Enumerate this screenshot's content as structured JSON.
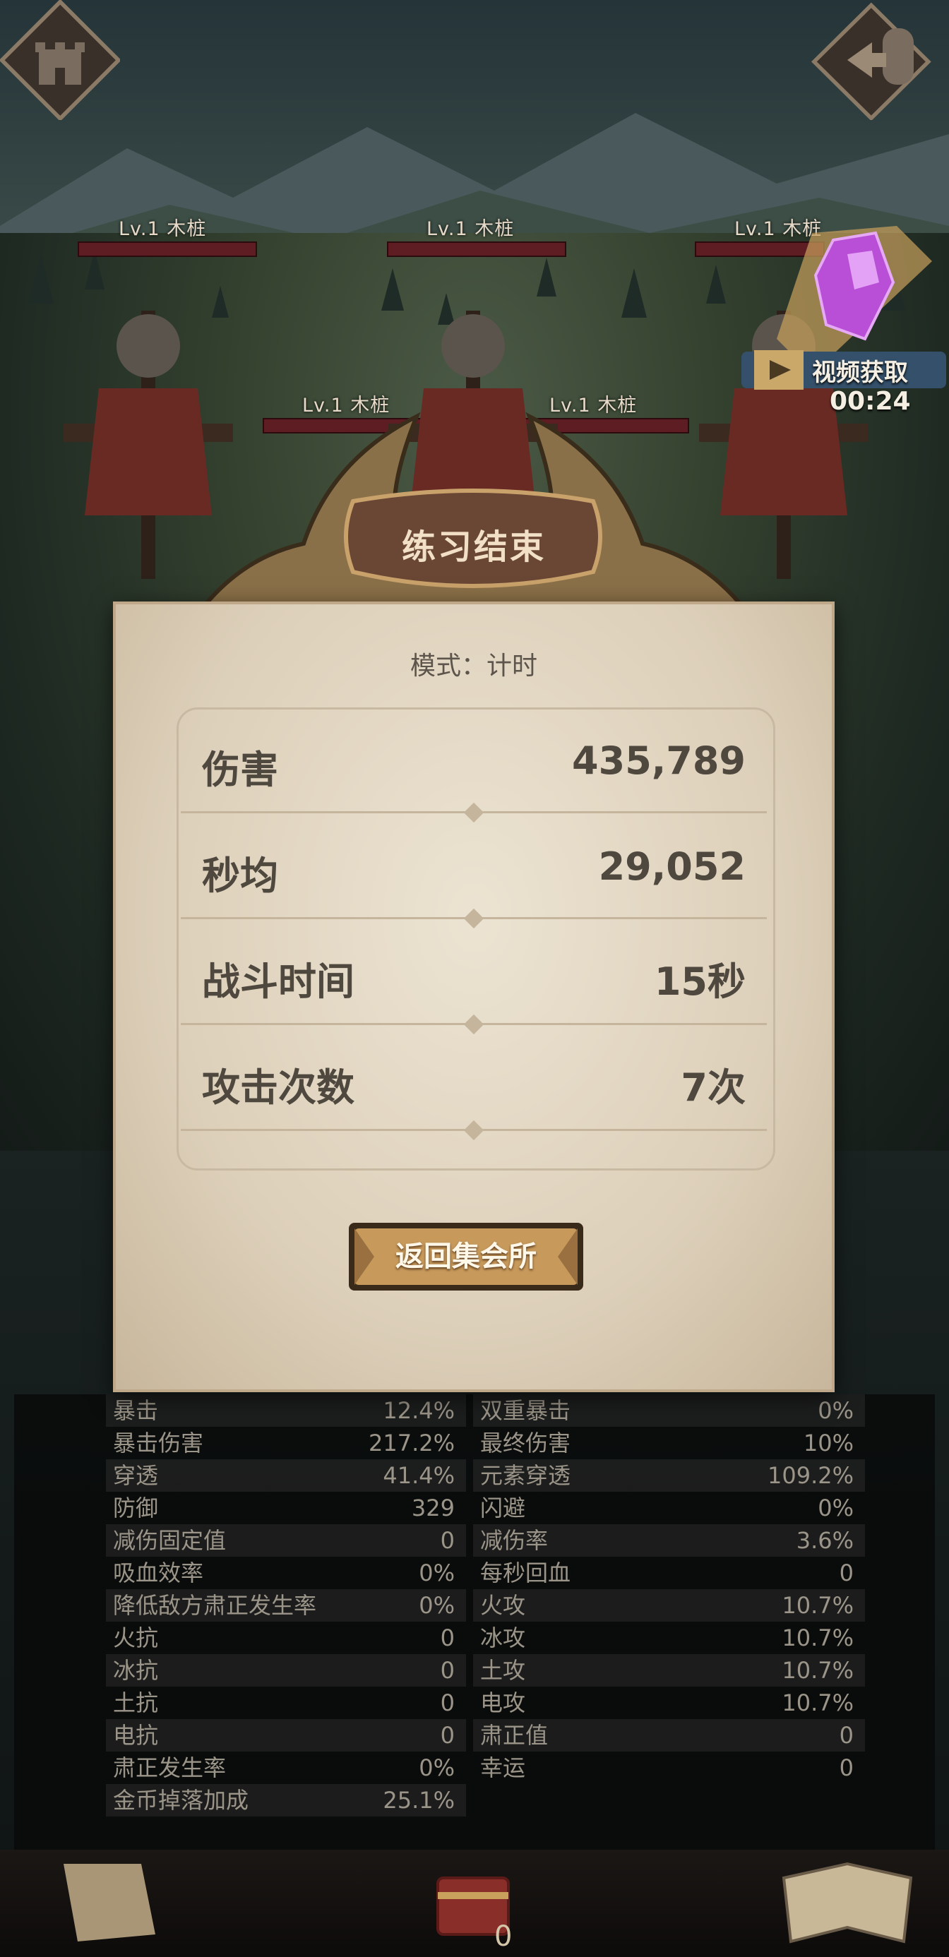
{
  "colors": {
    "panel_text": "#4f483f",
    "hp_bar": "#5e1d22",
    "stat_text": "#9b9488"
  },
  "icons": {
    "top_left": "castle-icon",
    "top_right": "exit-door-icon",
    "video": "film-icon",
    "reward": "purple-crystal-icon",
    "bottom_left": "scroll-icon",
    "bottom_center": "treasure-chest-icon",
    "bottom_right": "book-icon"
  },
  "enemies": [
    {
      "label": "Lv.1  木桩"
    },
    {
      "label": "Lv.1  木桩"
    },
    {
      "label": "Lv.1  木桩"
    },
    {
      "label": "Lv.1  木桩"
    },
    {
      "label": "Lv.1  木桩"
    }
  ],
  "video_reward": {
    "label": "视频获取",
    "timer": "00:24"
  },
  "result": {
    "title": "练习结束",
    "mode": "模式：计时",
    "rows": [
      {
        "label": "伤害",
        "value": "435,789"
      },
      {
        "label": "秒均",
        "value": "29,052"
      },
      {
        "label": "战斗时间",
        "value": "15秒"
      },
      {
        "label": "攻击次数",
        "value": "7次"
      }
    ],
    "return_button": "返回集会所"
  },
  "stats": {
    "left": [
      {
        "k": "暴击",
        "v": "12.4%"
      },
      {
        "k": "暴击伤害",
        "v": "217.2%"
      },
      {
        "k": "穿透",
        "v": "41.4%"
      },
      {
        "k": "防御",
        "v": "329"
      },
      {
        "k": "减伤固定值",
        "v": "0"
      },
      {
        "k": "吸血效率",
        "v": "0%"
      },
      {
        "k": "降低敌方肃正发生率",
        "v": "0%"
      },
      {
        "k": "火抗",
        "v": "0"
      },
      {
        "k": "冰抗",
        "v": "0"
      },
      {
        "k": "土抗",
        "v": "0"
      },
      {
        "k": "电抗",
        "v": "0"
      },
      {
        "k": "肃正发生率",
        "v": "0%"
      },
      {
        "k": "金币掉落加成",
        "v": "25.1%"
      }
    ],
    "right": [
      {
        "k": "双重暴击",
        "v": "0%"
      },
      {
        "k": "最终伤害",
        "v": "10%"
      },
      {
        "k": "元素穿透",
        "v": "109.2%"
      },
      {
        "k": "闪避",
        "v": "0%"
      },
      {
        "k": "减伤率",
        "v": "3.6%"
      },
      {
        "k": "每秒回血",
        "v": "0"
      },
      {
        "k": "火攻",
        "v": "10.7%"
      },
      {
        "k": "冰攻",
        "v": "10.7%"
      },
      {
        "k": "土攻",
        "v": "10.7%"
      },
      {
        "k": "电攻",
        "v": "10.7%"
      },
      {
        "k": "肃正值",
        "v": "0"
      },
      {
        "k": "幸运",
        "v": "0"
      }
    ]
  },
  "bottom_count": "0"
}
